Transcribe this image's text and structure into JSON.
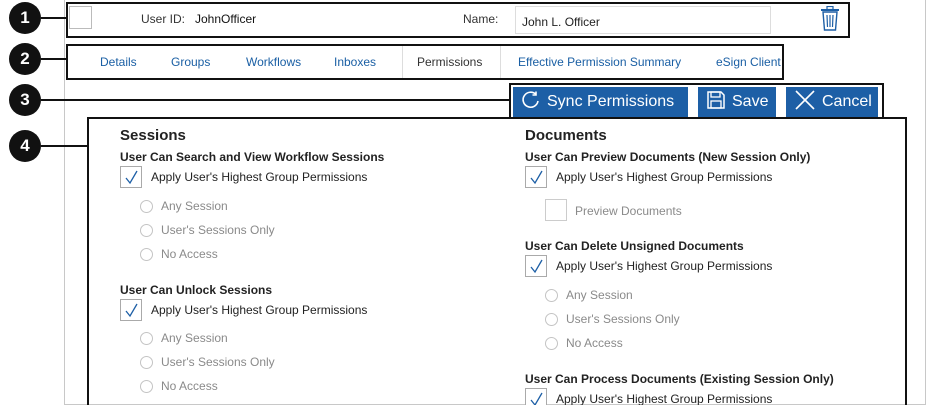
{
  "callouts": [
    "1",
    "2",
    "3",
    "4"
  ],
  "user_bar": {
    "user_id_label": "User ID:",
    "user_id_value": "JohnOfficer",
    "name_label": "Name:",
    "name_value": "John L. Officer"
  },
  "tabs": [
    {
      "label": "Details"
    },
    {
      "label": "Groups"
    },
    {
      "label": "Workflows"
    },
    {
      "label": "Inboxes"
    },
    {
      "label": "Permissions",
      "active": true
    },
    {
      "label": "Effective Permission Summary"
    },
    {
      "label": "eSign Client"
    }
  ],
  "actions": {
    "sync": "Sync Permissions",
    "save": "Save",
    "cancel": "Cancel"
  },
  "sessions": {
    "title": "Sessions",
    "search_view": {
      "title": "User Can Search and View Workflow Sessions",
      "apply": "Apply User's Highest Group Permissions",
      "options": [
        "Any Session",
        "User's Sessions Only",
        "No Access"
      ]
    },
    "unlock": {
      "title": "User Can Unlock Sessions",
      "apply": "Apply User's Highest Group Permissions",
      "options": [
        "Any Session",
        "User's Sessions Only",
        "No Access"
      ]
    }
  },
  "documents": {
    "title": "Documents",
    "preview": {
      "title": "User Can Preview Documents (New Session Only)",
      "apply": "Apply User's Highest Group Permissions",
      "option": "Preview Documents"
    },
    "delete_unsigned": {
      "title": "User Can Delete Unsigned Documents",
      "apply": "Apply User's Highest Group Permissions",
      "options": [
        "Any Session",
        "User's Sessions Only",
        "No Access"
      ]
    },
    "process": {
      "title": "User Can Process Documents (Existing Session Only)",
      "apply": "Apply User's Highest Group Permissions"
    }
  },
  "colors": {
    "accent": "#1d5fa6",
    "link": "#1a5fa4",
    "disabled_text": "#8a8a8a"
  }
}
